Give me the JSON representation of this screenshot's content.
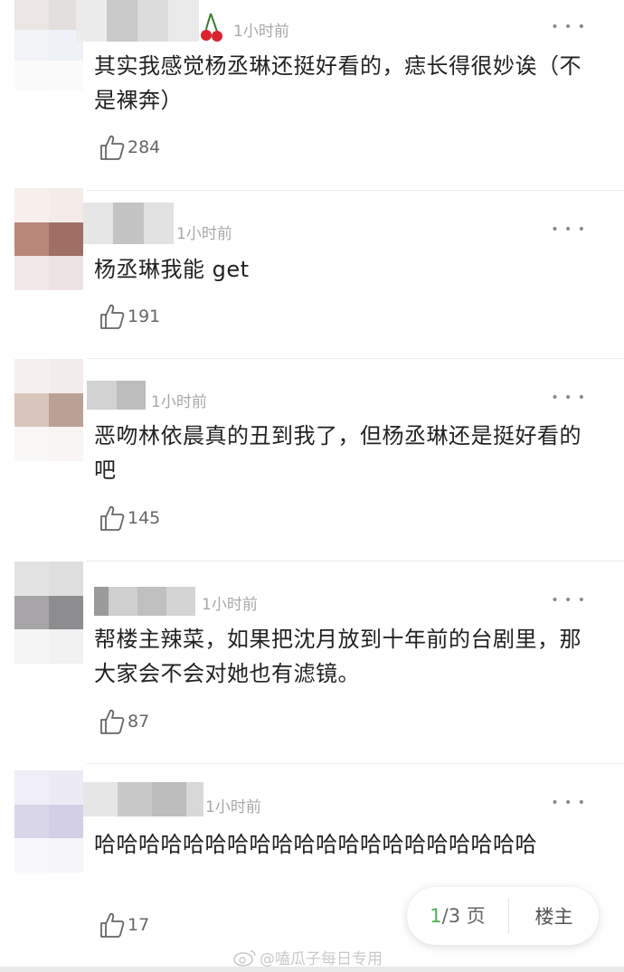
{
  "comments": [
    {
      "time": "1小时前",
      "text": "其实我感觉杨丞琳还挺好看的，痣长得很妙诶（不是裸奔）",
      "likes": "284"
    },
    {
      "time": "1小时前",
      "text": "杨丞琳我能 get",
      "likes": "191"
    },
    {
      "time": "1小时前",
      "text": "恶吻林依晨真的丑到我了，但杨丞琳还是挺好看的吧",
      "likes": "145"
    },
    {
      "time": "1小时前",
      "text": "帮楼主辣菜，如果把沈月放到十年前的台剧里，那大家会不会对她也有滤镜。",
      "likes": "87"
    },
    {
      "time": "1小时前",
      "text": "哈哈哈哈哈哈哈哈哈哈哈哈哈哈哈哈哈哈哈哈",
      "likes": "17"
    }
  ],
  "pager": {
    "current": "1",
    "total": "/3 页",
    "owner_label": "楼主"
  },
  "watermark": "@嗑瓜子每日专用",
  "icons": {
    "like": "thumbs-up-icon",
    "more": "more-dots-icon",
    "badge": "cherry-icon"
  },
  "colors": {
    "accent": "#4caf50",
    "time": "#a8a8a8"
  }
}
